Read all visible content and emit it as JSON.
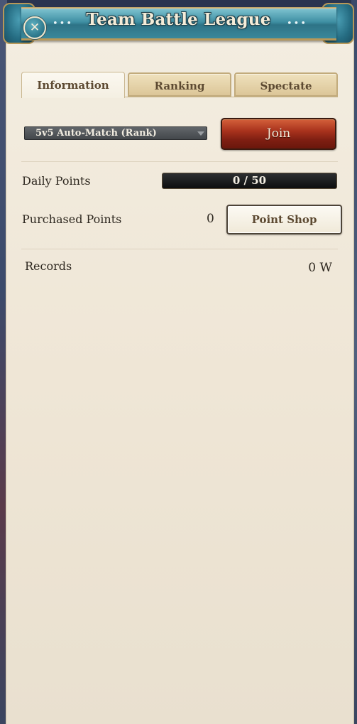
{
  "window": {
    "title": "Team Battle League",
    "close_icon": "close-x-icon"
  },
  "tabs": [
    {
      "label": "Information",
      "active": true
    },
    {
      "label": "Ranking",
      "active": false
    },
    {
      "label": "Spectate",
      "active": false
    }
  ],
  "match": {
    "mode_selected": "5v5 Auto-Match (Rank)",
    "join_label": "Join"
  },
  "daily_points": {
    "label": "Daily Points",
    "current": 0,
    "max": 50,
    "display": "0 / 50"
  },
  "purchased_points": {
    "label": "Purchased Points",
    "value": "0",
    "shop_label": "Point Shop"
  },
  "records": {
    "label": "Records",
    "value": "0 W"
  },
  "colors": {
    "title_band": "#3f8fa3",
    "join_button": "#a8321d",
    "panel_bg": "#f3ede0"
  }
}
